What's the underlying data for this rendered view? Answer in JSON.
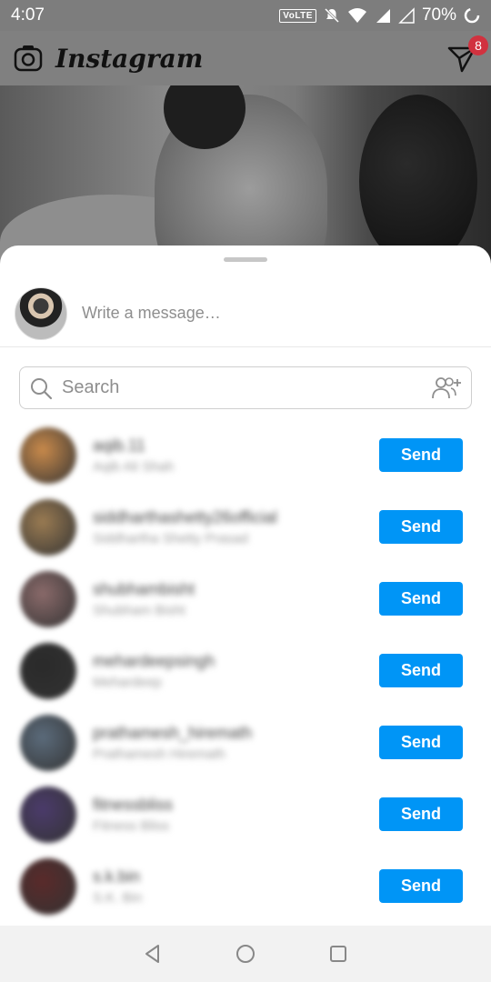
{
  "status_bar": {
    "time": "4:07",
    "volte": "VoLTE",
    "battery": "70%"
  },
  "header": {
    "app_name": "Instagram",
    "dm_badge": "8"
  },
  "share_sheet": {
    "message_placeholder": "Write a message…",
    "search_placeholder": "Search",
    "contacts": [
      {
        "name": "aqib.11",
        "subtitle": "Aqib Ali Shah",
        "send_label": "Send",
        "avatar_color": "#c98a4b"
      },
      {
        "name": "siddharthashetty26official",
        "subtitle": "Siddhartha Shetty Prasad",
        "send_label": "Send",
        "avatar_color": "#9a7b52"
      },
      {
        "name": "shubhambisht",
        "subtitle": "Shubham Bisht",
        "send_label": "Send",
        "avatar_color": "#8a6a6a"
      },
      {
        "name": "mehardeepsingh",
        "subtitle": "Mehardeep",
        "send_label": "Send",
        "avatar_color": "#2a2a2a"
      },
      {
        "name": "prathamesh_hiremath",
        "subtitle": "Prathamesh Hiremath",
        "send_label": "Send",
        "avatar_color": "#5b6b7b"
      },
      {
        "name": "fitnessbliss",
        "subtitle": "Fitness Bliss",
        "send_label": "Send",
        "avatar_color": "#4b3b6b"
      },
      {
        "name": "s.k.bin",
        "subtitle": "S.K. Bin",
        "send_label": "Send",
        "avatar_color": "#5a2a2a"
      }
    ]
  },
  "colors": {
    "send_button": "#0095f6",
    "badge": "#d1323f"
  }
}
